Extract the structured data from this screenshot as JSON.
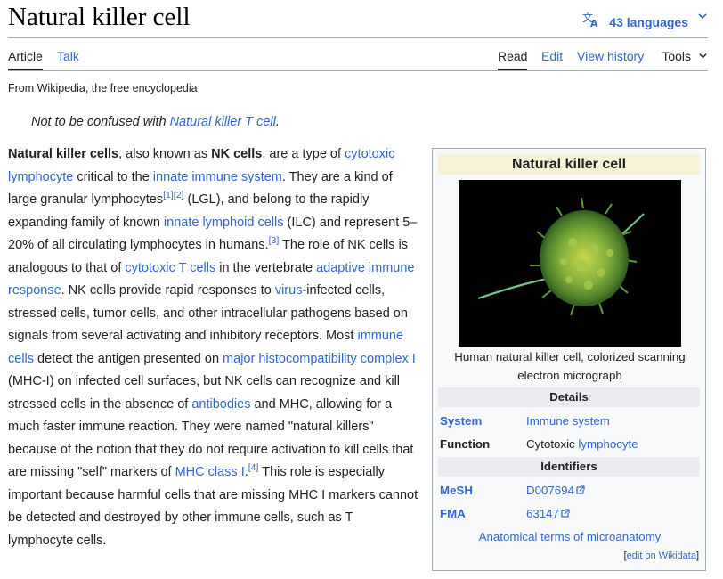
{
  "header": {
    "title": "Natural killer cell",
    "languages_label": "43 languages",
    "translate_icon": "translate-icon",
    "chevron": "chevron-down-icon"
  },
  "tabs": {
    "article": "Article",
    "talk": "Talk",
    "read": "Read",
    "edit": "Edit",
    "history": "View history",
    "tools": "Tools"
  },
  "tagline": "From Wikipedia, the free encyclopedia",
  "hatnote": {
    "prefix": "Not to be confused with ",
    "link": "Natural killer T cell",
    "suffix": "."
  },
  "article": {
    "t0": "Natural killer cells",
    "t1": ", also known as ",
    "t2": "NK cells",
    "t3": ", are a type of ",
    "l_cytotoxic_lymphocyte": "cytotoxic lymphocyte",
    "t4": " critical to the ",
    "l_innate_immune_system": "innate immune system",
    "t5": ". They are a kind of large granular lymphocytes",
    "ref1": "[1]",
    "ref2": "[2]",
    "t6": " (LGL), and belong to the rapidly expanding family of known ",
    "l_innate_lymphoid_cells": "innate lymphoid cells",
    "t7": " (ILC) and represent 5–20% of all circulating lymphocytes in humans.",
    "ref3": "[3]",
    "t8": " The role of NK cells is analogous to that of ",
    "l_cytotoxic_t_cells": "cytotoxic T cells",
    "t9": " in the vertebrate ",
    "l_adaptive_immune_response": "adaptive immune response",
    "t10": ". NK cells provide rapid responses to ",
    "l_virus": "virus",
    "t11": "-infected cells, stressed cells, tumor cells, and other intracellular pathogens based on signals from several activating and inhibitory receptors. Most ",
    "l_immune_cells": "immune cells",
    "t12": " detect the antigen presented on ",
    "l_mhc": "major histocompatibility complex I",
    "t13": " (MHC-I) on infected cell surfaces, but NK cells can recognize and kill stressed cells in the absence of ",
    "l_antibodies": "antibodies",
    "t14": " and MHC, allowing for a much faster immune reaction. They were named \"natural killers\" because of the notion that they do not require activation to kill cells that are missing \"self\" markers of ",
    "l_mhc_class_i": "MHC class I",
    "t15": ".",
    "ref4": "[4]",
    "t16": " This role is especially important because harmful cells that are missing MHC I markers cannot be detected and destroyed by other immune cells, such as T lymphocyte cells."
  },
  "infobox": {
    "title": "Natural killer cell",
    "caption": "Human natural killer cell, colorized scanning electron micrograph",
    "details_header": "Details",
    "system_label": "System",
    "system_value": "Immune system",
    "function_label": "Function",
    "function_value_prefix": "Cytotoxic ",
    "function_value_link": "lymphocyte",
    "identifiers_header": "Identifiers",
    "mesh_label": "MeSH",
    "mesh_value": "D007694",
    "fma_label": "FMA",
    "fma_value": "63147",
    "anatomical_terms": "Anatomical terms of microanatomy",
    "edit_bracket_open": "[",
    "edit_link": "edit on Wikidata",
    "edit_bracket_close": "]"
  }
}
